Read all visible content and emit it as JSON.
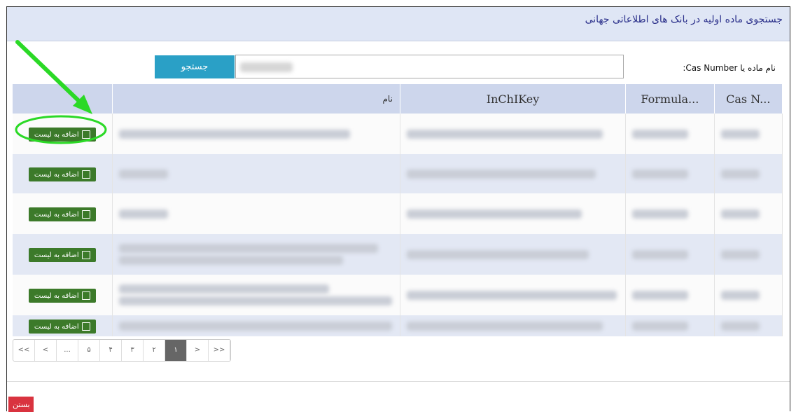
{
  "title": "جستجوی ماده اولیه در بانک های اطلاعاتی جهانی",
  "search": {
    "label": "نام ماده یا Cas Number:",
    "button": "جستجو",
    "value": ""
  },
  "table": {
    "headers": {
      "cas": "Cas N...",
      "formula": "Formula...",
      "inchikey": "InChIKey",
      "name": "نام",
      "action": ""
    },
    "add_label": "اضافه به لیست",
    "rows": [
      {
        "id": 1
      },
      {
        "id": 2
      },
      {
        "id": 3
      },
      {
        "id": 4
      },
      {
        "id": 5
      },
      {
        "id": 6
      }
    ]
  },
  "pagination": [
    "<<",
    "<",
    "...",
    "۵",
    "۴",
    "۳",
    "۲",
    "۱",
    ">",
    ">>"
  ],
  "pagination_active": "۱",
  "close_label": "بستن",
  "colors": {
    "header": "#dfe6f5",
    "table_header": "#cdd6ec",
    "add": "#3c7a2a",
    "search": "#2aa0c6",
    "close": "#d9333f",
    "highlight": "#2bd926"
  }
}
